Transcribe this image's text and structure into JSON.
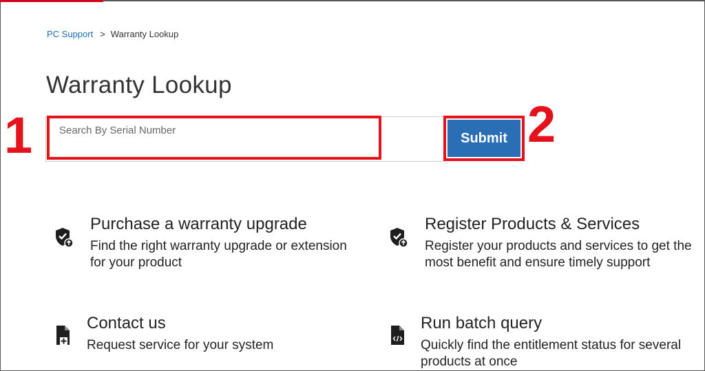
{
  "breadcrumb": {
    "parent": "PC Support",
    "separator": ">",
    "current": "Warranty Lookup"
  },
  "page": {
    "title": "Warranty Lookup"
  },
  "search": {
    "placeholder": "Search By Serial Number",
    "value": ""
  },
  "actions": {
    "submit_label": "Submit"
  },
  "annotations": {
    "marker1": "1",
    "marker2": "2"
  },
  "cards": [
    {
      "title": "Purchase a warranty upgrade",
      "line1": "Find the right warranty upgrade or extension",
      "line2": "for your product",
      "icon": "shield-check-upgrade-icon"
    },
    {
      "title": "Register Products & Services",
      "line1": "Register your products and services to get the",
      "line2": "most benefit and ensure timely support",
      "icon": "shield-check-upgrade-icon"
    },
    {
      "title": "Contact us",
      "line1": "Request service for your system",
      "line2": "",
      "icon": "document-add-icon"
    },
    {
      "title": "Run batch query",
      "line1": "Quickly find the entitlement status for several",
      "line2": "products at once",
      "icon": "document-code-icon"
    }
  ],
  "colors": {
    "accent_blue": "#2a6fb5",
    "link_blue": "#1f6fb2",
    "annotation_red": "#e3121b"
  }
}
